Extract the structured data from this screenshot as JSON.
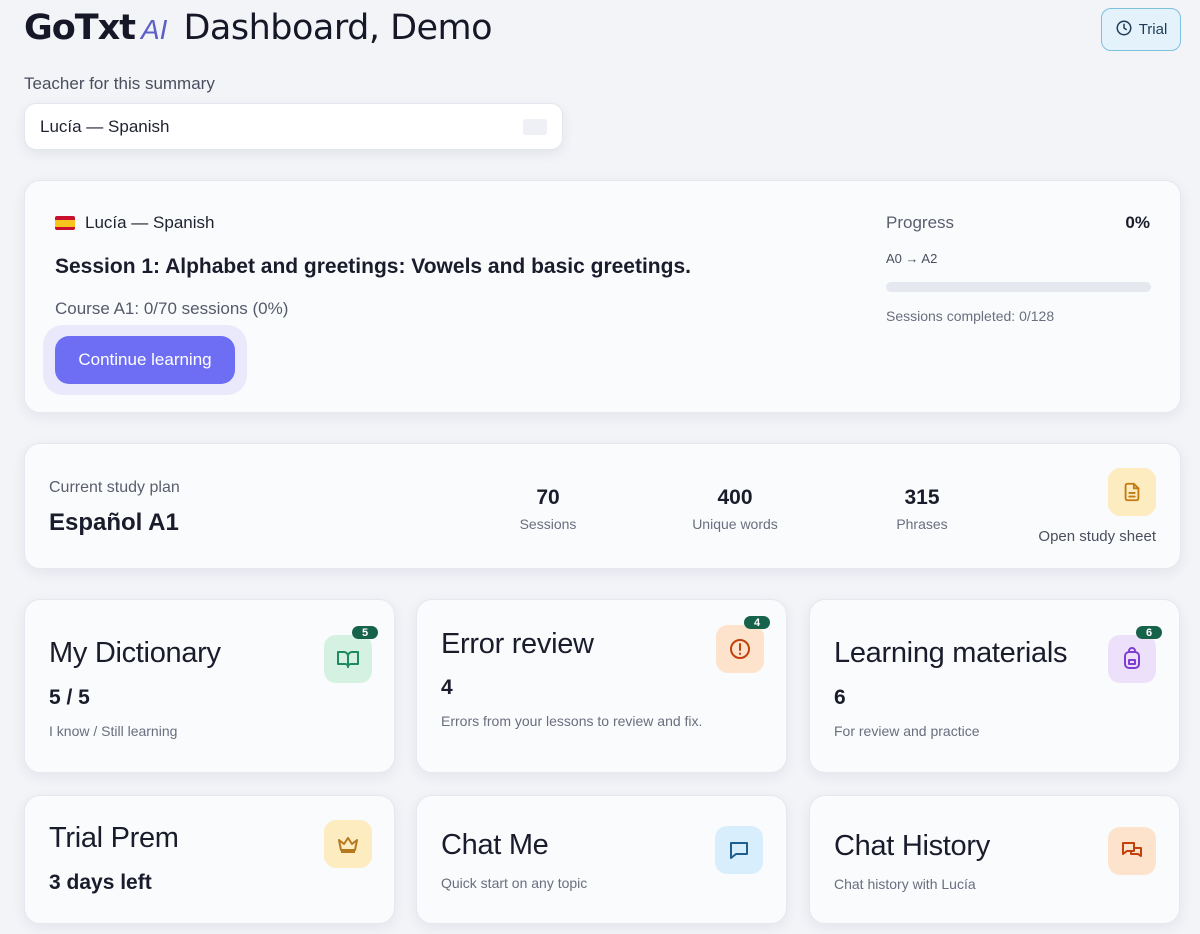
{
  "header": {
    "logo": "GoTxt",
    "logo_ai": "AI",
    "title": "Dashboard, Demo",
    "trial_label": "Trial"
  },
  "teacher": {
    "label": "Teacher for this summary",
    "selected": "Lucía — Spanish"
  },
  "session": {
    "teacher": "Lucía — Spanish",
    "title": "Session 1: Alphabet and greetings: Vowels and basic greetings.",
    "course": "Course A1: 0/70 sessions (0%)",
    "continue_label": "Continue learning",
    "progress_label": "Progress",
    "progress_pct": "0%",
    "progress_value": 0,
    "progress_range": "A0 → A2",
    "sessions_completed": "Sessions completed: 0/128"
  },
  "plan": {
    "label": "Current study plan",
    "name": "Español A1",
    "stats": [
      {
        "value": "70",
        "label": "Sessions"
      },
      {
        "value": "400",
        "label": "Unique words"
      },
      {
        "value": "315",
        "label": "Phrases"
      }
    ],
    "open_sheet_label": "Open study sheet"
  },
  "tiles": {
    "dictionary": {
      "title": "My Dictionary",
      "value": "5 / 5",
      "desc": "I know / Still learning",
      "badge": "5",
      "icon": "book-open-icon"
    },
    "errors": {
      "title": "Error review",
      "value": "4",
      "desc": "Errors from your lessons to review and fix.",
      "badge": "4",
      "icon": "alert-circle-icon"
    },
    "materials": {
      "title": "Learning materials",
      "value": "6",
      "desc": "For review and practice",
      "badge": "6",
      "icon": "backpack-icon"
    },
    "trial": {
      "title": "Trial Prem",
      "value": "3 days left",
      "icon": "crown-icon"
    },
    "chat": {
      "title": "Chat Me",
      "desc": "Quick start on any topic",
      "icon": "message-square-icon"
    },
    "history": {
      "title": "Chat History",
      "desc": "Chat history with Lucía",
      "icon": "messages-icon"
    }
  },
  "colors": {
    "accent": "#6e6ef5",
    "badge": "#17624b",
    "background": "#f3f4f8"
  }
}
